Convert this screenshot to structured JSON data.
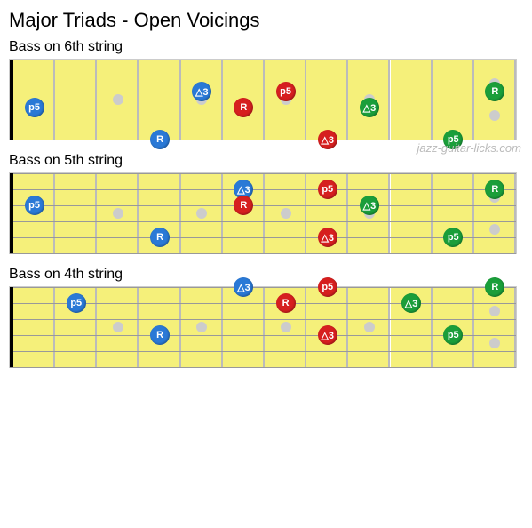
{
  "title": "Major Triads - Open Voicings",
  "attribution": "jazz-guitar-licks.com",
  "fretboard": {
    "frets": 12,
    "strings": 6,
    "inlays_single": [
      3,
      5,
      7,
      9
    ],
    "inlays_double": [
      12
    ]
  },
  "colors": {
    "R": "#2a79d6",
    "3": "#1a9e3a",
    "p5": "#d61f1f",
    "R2": "#d61f1f",
    "32": "#2a79d6",
    "p52": "#1a9e3a",
    "Rg": "#1a9e3a",
    "3b": "#2a79d6",
    "p5b": "#2a79d6"
  },
  "diagrams": [
    {
      "subtitle": "Bass  on 6th string",
      "notes": [
        {
          "fret": 1,
          "string": 4,
          "label": "p5",
          "color": "#2a79d6"
        },
        {
          "fret": 4,
          "string": 6,
          "label": "R",
          "color": "#2a79d6"
        },
        {
          "fret": 5,
          "string": 3,
          "label": "△3",
          "color": "#2a79d6"
        },
        {
          "fret": 6,
          "string": 4,
          "label": "R",
          "color": "#d61f1f"
        },
        {
          "fret": 8,
          "string": 6,
          "label": "△3",
          "color": "#d61f1f"
        },
        {
          "fret": 7,
          "string": 3,
          "label": "p5",
          "color": "#d61f1f"
        },
        {
          "fret": 9,
          "string": 4,
          "label": "△3",
          "color": "#1a9e3a"
        },
        {
          "fret": 11,
          "string": 6,
          "label": "p5",
          "color": "#1a9e3a"
        },
        {
          "fret": 12,
          "string": 3,
          "label": "R",
          "color": "#1a9e3a"
        }
      ]
    },
    {
      "subtitle": "Bass  on 5th string",
      "notes": [
        {
          "fret": 1,
          "string": 3,
          "label": "p5",
          "color": "#2a79d6"
        },
        {
          "fret": 4,
          "string": 5,
          "label": "R",
          "color": "#2a79d6"
        },
        {
          "fret": 6,
          "string": 2,
          "label": "△3",
          "color": "#2a79d6"
        },
        {
          "fret": 6,
          "string": 3,
          "label": "R",
          "color": "#d61f1f"
        },
        {
          "fret": 8,
          "string": 5,
          "label": "△3",
          "color": "#d61f1f"
        },
        {
          "fret": 8,
          "string": 2,
          "label": "p5",
          "color": "#d61f1f"
        },
        {
          "fret": 9,
          "string": 3,
          "label": "△3",
          "color": "#1a9e3a"
        },
        {
          "fret": 11,
          "string": 5,
          "label": "p5",
          "color": "#1a9e3a"
        },
        {
          "fret": 12,
          "string": 2,
          "label": "R",
          "color": "#1a9e3a"
        }
      ]
    },
    {
      "subtitle": "Bass  on 4th string",
      "notes": [
        {
          "fret": 2,
          "string": 2,
          "label": "p5",
          "color": "#2a79d6"
        },
        {
          "fret": 4,
          "string": 4,
          "label": "R",
          "color": "#2a79d6"
        },
        {
          "fret": 6,
          "string": 1,
          "label": "△3",
          "color": "#2a79d6"
        },
        {
          "fret": 7,
          "string": 2,
          "label": "R",
          "color": "#d61f1f"
        },
        {
          "fret": 8,
          "string": 4,
          "label": "△3",
          "color": "#d61f1f"
        },
        {
          "fret": 8,
          "string": 1,
          "label": "p5",
          "color": "#d61f1f"
        },
        {
          "fret": 10,
          "string": 2,
          "label": "△3",
          "color": "#1a9e3a"
        },
        {
          "fret": 11,
          "string": 4,
          "label": "p5",
          "color": "#1a9e3a"
        },
        {
          "fret": 12,
          "string": 1,
          "label": "R",
          "color": "#1a9e3a"
        }
      ]
    }
  ]
}
